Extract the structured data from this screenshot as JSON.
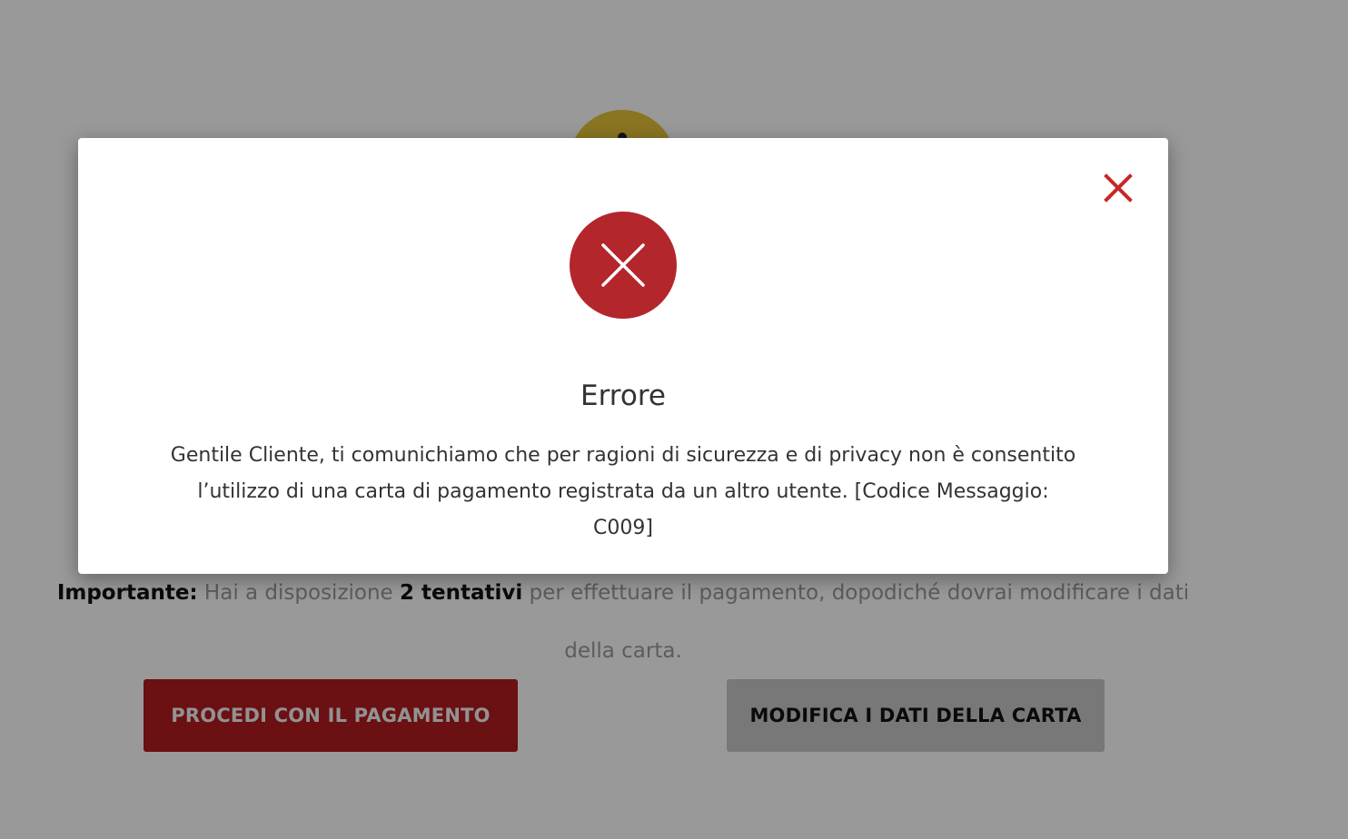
{
  "background": {
    "notice": {
      "important_label": "Importante:",
      "text_before": " Hai a disposizione ",
      "attempts": "2 tentativi",
      "text_after": " per effettuare il pagamento, dopodiché dovrai modificare i dati",
      "text_line2": "della carta."
    },
    "buttons": {
      "pay_label": "PROCEDI CON IL PAGAMENTO",
      "edit_label": "MODIFICA I DATI DELLA CARTA"
    }
  },
  "modal": {
    "title": "Errore",
    "message": "Gentile Cliente, ti comunichiamo che per ragioni di sicurezza e di privacy non è consentito l’utilizzo di una carta di pagamento registrata da un altro utente. [Codice Messaggio: C009]",
    "close_icon": "close-icon",
    "status_icon": "error-icon"
  },
  "colors": {
    "error_red": "#b3262b",
    "close_red": "#c62828",
    "pay_button": "#b31c21",
    "edit_button": "#c8c8c8",
    "warning_yellow": "#e6c43a",
    "overlay": "rgba(0,0,0,0.4)"
  }
}
